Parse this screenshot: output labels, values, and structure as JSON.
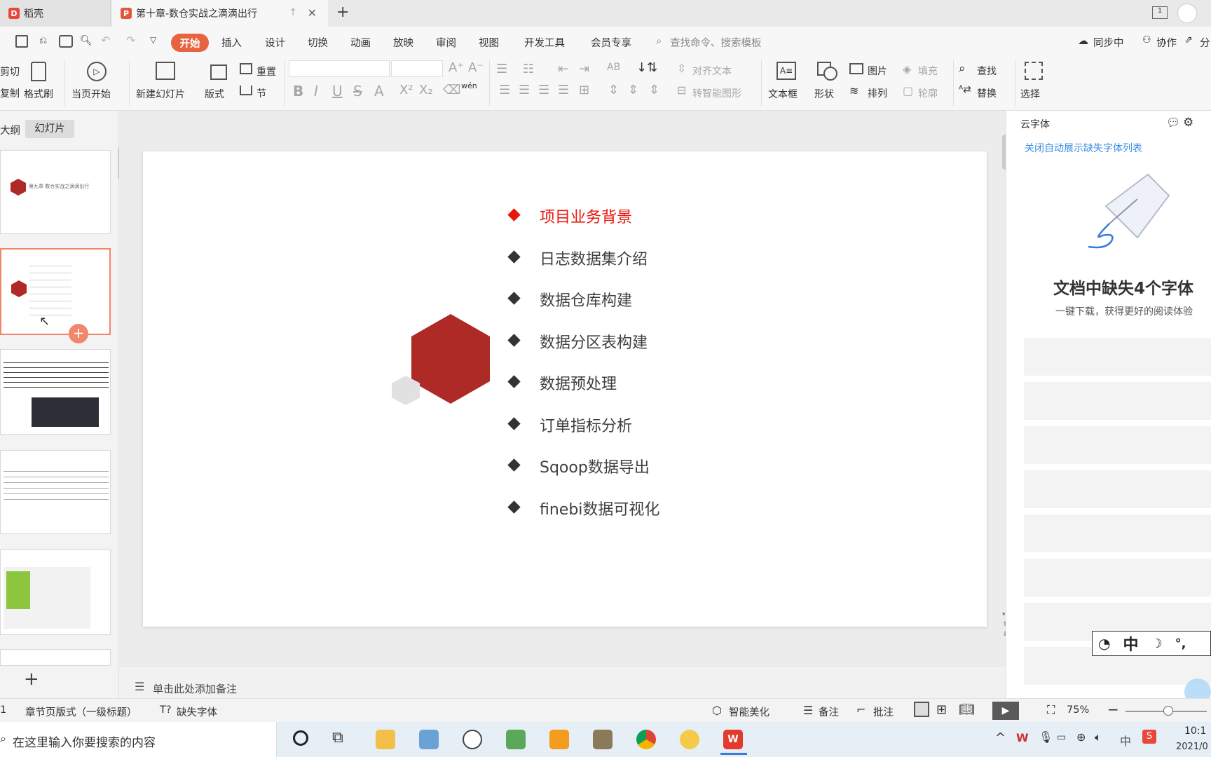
{
  "tabs": {
    "home": "稻壳",
    "doc": "第十章-数仓实战之滴滴出行"
  },
  "menu": {
    "start": "开始",
    "insert": "插入",
    "design": "设计",
    "transition": "切换",
    "animation": "动画",
    "slideshow": "放映",
    "review": "审阅",
    "view": "视图",
    "devtools": "开发工具",
    "member": "会员专享",
    "search_placeholder": "查找命令、搜索模板",
    "sync": "同步中",
    "collab": "协作",
    "share": "分"
  },
  "ribbon": {
    "cut": "剪切",
    "copy": "复制",
    "format_painter": "格式刷",
    "from_current": "当页开始",
    "new_slide": "新建幻灯片",
    "layout": "版式",
    "reset": "重置",
    "section": "节",
    "align_text": "对齐文本",
    "smart_graphic": "转智能图形",
    "textbox": "文本框",
    "shape": "形状",
    "picture": "图片",
    "arrange": "排列",
    "fill": "填充",
    "outline": "轮廓",
    "find": "查找",
    "replace": "替换",
    "select": "选择",
    "wen": "wén"
  },
  "left_tabs": {
    "outline": "大纲",
    "slides": "幻灯片"
  },
  "thumb1_text": "第九章  数仓实战之滴滴出行",
  "slide": {
    "items": [
      "项目业务背景",
      "日志数据集介绍",
      "数据仓库构建",
      "数据分区表构建",
      "数据预处理",
      "订单指标分析",
      "Sqoop数据导出",
      "finebi数据可视化"
    ],
    "active_color": "#e8170c",
    "hex_color": "#ad2a27"
  },
  "notes_placeholder": "单击此处添加备注",
  "right_pane": {
    "cloud_fonts": "云字体",
    "close_link": "关闭自动展示缺失字体列表",
    "heading": "文档中缺失4个字体",
    "sub": "一键下载，获得更好的阅读体验"
  },
  "status": {
    "page": "1",
    "layout_name": "章节页版式（一级标题）",
    "missing_font": "缺失字体",
    "beautify": "智能美化",
    "notes": "备注",
    "comment": "批注",
    "zoom": "75%"
  },
  "taskbar": {
    "search_placeholder": "在这里输入你要搜索的内容",
    "time": "10:1",
    "date": "2021/0",
    "ime": "中"
  },
  "ime_bar": {
    "label": "中"
  }
}
